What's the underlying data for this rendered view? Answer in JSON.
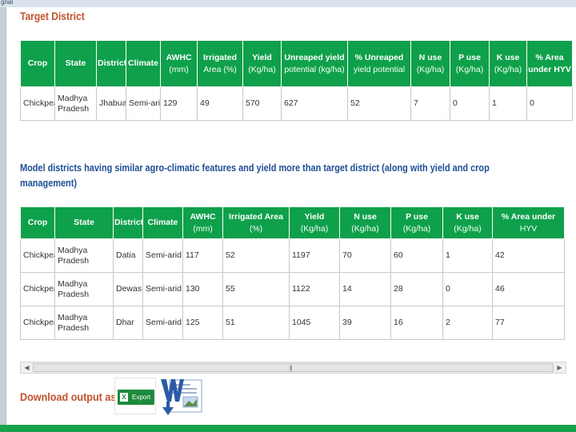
{
  "window": {
    "corner_label": "gnal"
  },
  "target_section": {
    "title": "Target District",
    "columns": [
      {
        "label": "Crop",
        "sub": ""
      },
      {
        "label": "State",
        "sub": ""
      },
      {
        "label": "District",
        "sub": ""
      },
      {
        "label": "Climate",
        "sub": ""
      },
      {
        "label": "AWHC",
        "sub": "(mm)"
      },
      {
        "label": "Irrigated",
        "sub": "Area (%)"
      },
      {
        "label": "Yield",
        "sub": "(Kg/ha)"
      },
      {
        "label": "Unreaped yield",
        "sub": "potential (kg/ha)"
      },
      {
        "label": "% Unreaped",
        "sub": "yield potential"
      },
      {
        "label": "N use",
        "sub": "(Kg/ha)"
      },
      {
        "label": "P use",
        "sub": "(Kg/ha)"
      },
      {
        "label": "K use",
        "sub": "(Kg/ha)"
      },
      {
        "label": "% Area under HYV",
        "sub": ""
      }
    ],
    "rows": [
      [
        "Chickpea",
        "Madhya Pradesh",
        "Jhabua",
        "Semi-arid",
        "129",
        "49",
        "570",
        "627",
        "52",
        "7",
        "0",
        "1",
        "0"
      ]
    ]
  },
  "model_section": {
    "title": "Model districts having similar agro-climatic features and yield more than target district (along with yield and crop management)",
    "columns": [
      {
        "label": "Crop",
        "sub": ""
      },
      {
        "label": "State",
        "sub": ""
      },
      {
        "label": "District",
        "sub": ""
      },
      {
        "label": "Climate",
        "sub": ""
      },
      {
        "label": "AWHC",
        "sub": "(mm)"
      },
      {
        "label": "Irrigated Area",
        "sub": "(%)"
      },
      {
        "label": "Yield",
        "sub": "(Kg/ha)"
      },
      {
        "label": "N use",
        "sub": "(Kg/ha)"
      },
      {
        "label": "P use",
        "sub": "(Kg/ha)"
      },
      {
        "label": "K use",
        "sub": "(Kg/ha)"
      },
      {
        "label": "% Area under",
        "sub": "HYV"
      }
    ],
    "rows": [
      [
        "Chickpea",
        "Madhya Pradesh",
        "Datia",
        "Semi-arid",
        "117",
        "52",
        "1197",
        "70",
        "60",
        "1",
        "42"
      ],
      [
        "Chickpea",
        "Madhya Pradesh",
        "Dewas",
        "Semi-arid",
        "130",
        "55",
        "1122",
        "14",
        "28",
        "0",
        "46"
      ],
      [
        "Chickpea",
        "Madhya Pradesh",
        "Dhar",
        "Semi-arid",
        "125",
        "51",
        "1045",
        "39",
        "16",
        "2",
        "77"
      ]
    ]
  },
  "scrollbar": {
    "icon": "horizontal-scrollbar"
  },
  "download": {
    "label": "Download output as",
    "excel_button_label": "Export",
    "excel_icon": "excel-icon",
    "word_icon": "word-download-icon"
  },
  "colors": {
    "header_green": "#0fa04b",
    "target_title": "#c0522c",
    "model_title": "#1e4f96",
    "footer_green": "#17a34a"
  }
}
